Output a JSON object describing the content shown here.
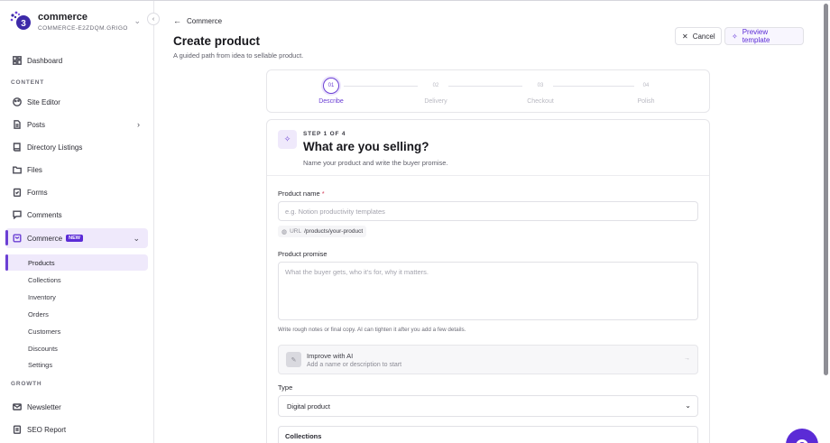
{
  "workspace": {
    "name": "commerce",
    "id": "COMMERCE-E2ZDQM.GRIGO..."
  },
  "sidebar": {
    "dashboard": "Dashboard",
    "content_label": "CONTENT",
    "site_editor": "Site Editor",
    "posts": "Posts",
    "directory": "Directory Listings",
    "files": "Files",
    "forms": "Forms",
    "comments": "Comments",
    "commerce": "Commerce",
    "commerce_badge": "NEW",
    "sub": [
      "Products",
      "Collections",
      "Inventory",
      "Orders",
      "Customers",
      "Discounts",
      "Settings"
    ],
    "growth_label": "GROWTH",
    "newsletter": "Newsletter",
    "seo": "SEO Report"
  },
  "header": {
    "back": "Commerce",
    "title": "Create product",
    "subtitle": "A guided path from idea to sellable product.",
    "cancel": "Cancel",
    "preview": "Preview template"
  },
  "steps": [
    {
      "num": "01",
      "label": "Describe"
    },
    {
      "num": "02",
      "label": "Delivery"
    },
    {
      "num": "03",
      "label": "Checkout"
    },
    {
      "num": "04",
      "label": "Polish"
    }
  ],
  "form": {
    "kicker": "STEP 1 OF 4",
    "title": "What are you selling?",
    "desc": "Name your product and write the buyer promise.",
    "name_label": "Product name",
    "name_req": "*",
    "name_placeholder": "e.g. Notion productivity templates",
    "url_prefix": "URL",
    "url_path": "/products/your-product",
    "promise_label": "Product promise",
    "promise_placeholder": "What the buyer gets, who it's for, why it matters.",
    "helper": "Write rough notes or final copy. AI can tighten it after you add a few details.",
    "ai_title": "Improve with AI",
    "ai_sub": "Add a name or description to start",
    "type_label": "Type",
    "type_value": "Digital product",
    "collections_label": "Collections"
  },
  "colors": {
    "accent": "#6b3fd4",
    "brand": "#5b2bd6"
  }
}
